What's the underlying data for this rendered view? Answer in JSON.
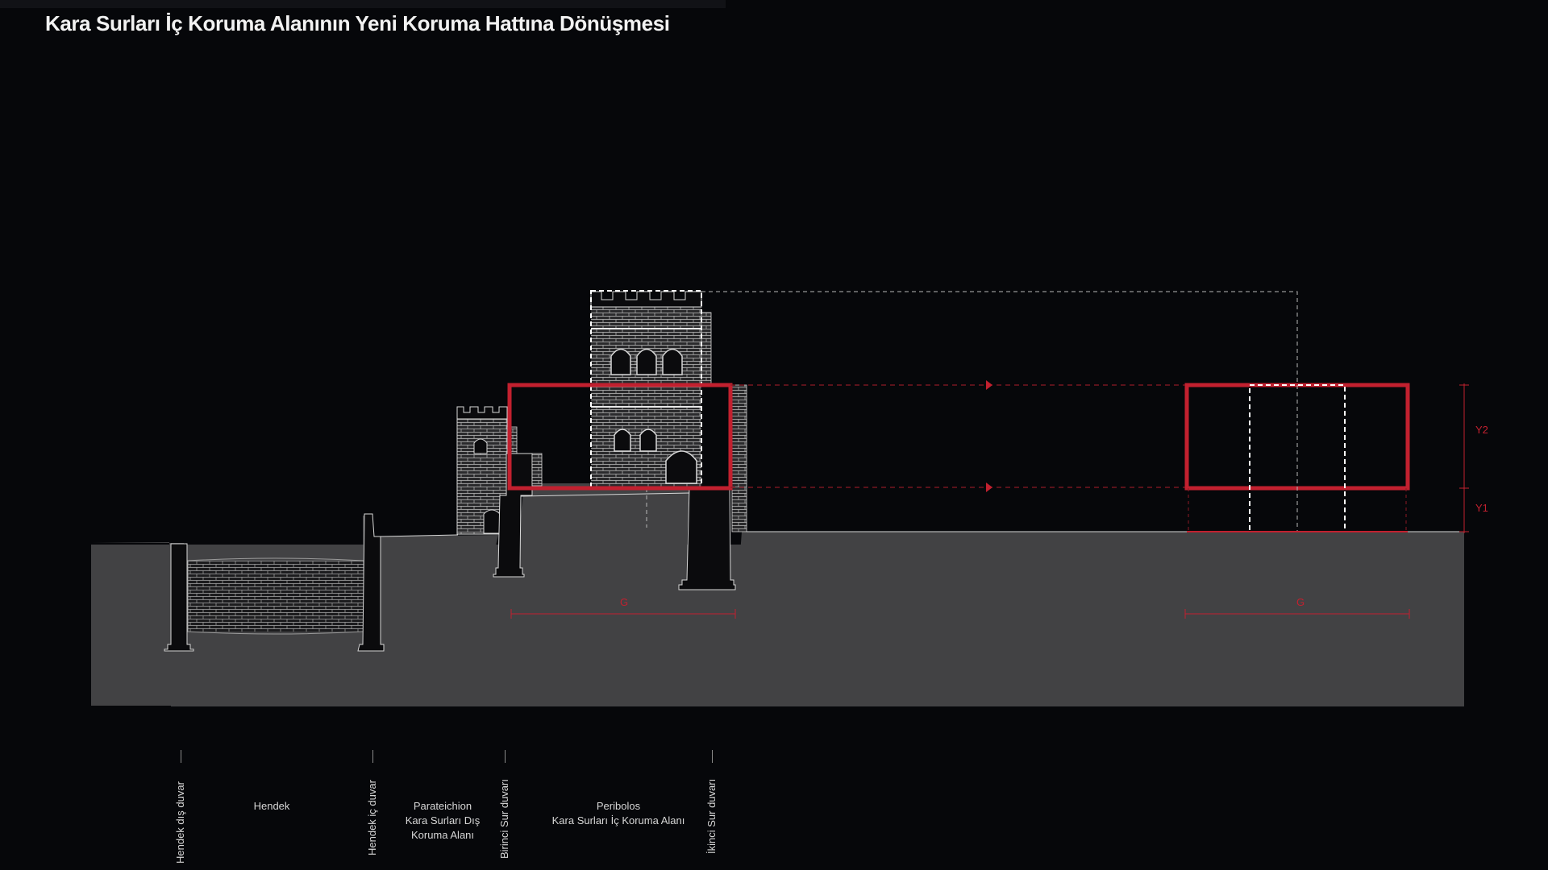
{
  "title": "Kara Surları İç Koruma Alanının Yeni Koruma Hattına Dönüşmesi",
  "dimensions": {
    "g_left": "G",
    "g_right": "G",
    "y2": "Y2",
    "y1": "Y1"
  },
  "wall_labels": {
    "hendek_dis_duvar": "Hendek dış duvar",
    "hendek_ic_duvar": "Hendek iç duvar",
    "birinci_sur_duvari": "Birinci Sur duvarı",
    "ikinci_sur_duvari": "İkinci Sur duvarı"
  },
  "zones": {
    "hendek": [
      "Hendek"
    ],
    "parateichion": [
      "Parateichion",
      "Kara Surları Dış",
      "Koruma Alanı"
    ],
    "peribolos": [
      "Peribolos",
      "Kara Surları İç Koruma Alanı"
    ]
  },
  "colors": {
    "background": "#06070a",
    "ground": "#424244",
    "accent_red": "#c2202f",
    "line_white": "#e8e8e8"
  }
}
